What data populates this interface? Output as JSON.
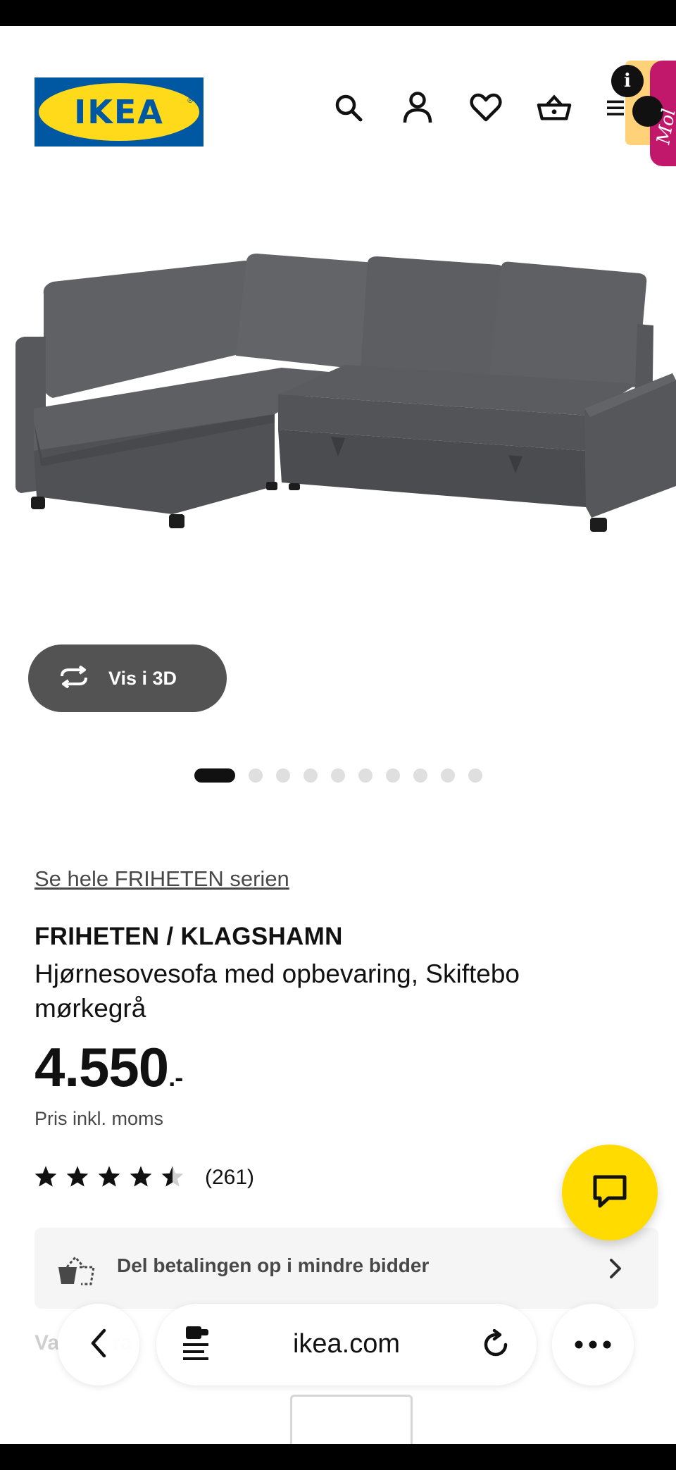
{
  "header": {
    "logo_text": "IKEA",
    "logo_reg": "®",
    "icons": [
      "search-icon",
      "account-icon",
      "heart-icon",
      "cart-icon",
      "menu-icon"
    ],
    "badge_text": "i",
    "colors": {
      "logo_blue": "#0058a3",
      "logo_yellow": "#ffda1a"
    }
  },
  "gallery": {
    "view_3d_label": "Vis i 3D",
    "image_count": 10,
    "active_index": 0
  },
  "product": {
    "series_link": "Se hele FRIHETEN serien",
    "name": "FRIHETEN / KLAGSHAMN",
    "description": "Hjørnesovesofa med opbevaring, Skiftebo mørkegrå",
    "price": "4.550",
    "price_suffix": ".-",
    "price_note": "Pris inkl. moms",
    "rating": 4.5,
    "rating_max": 5,
    "review_count": "(261)"
  },
  "payment": {
    "label": "Del betalingen op i mindre bidder"
  },
  "variant_peek": "Va         ra",
  "chat": {
    "color": "#ffdb00"
  },
  "browser": {
    "domain": "ikea.com"
  }
}
